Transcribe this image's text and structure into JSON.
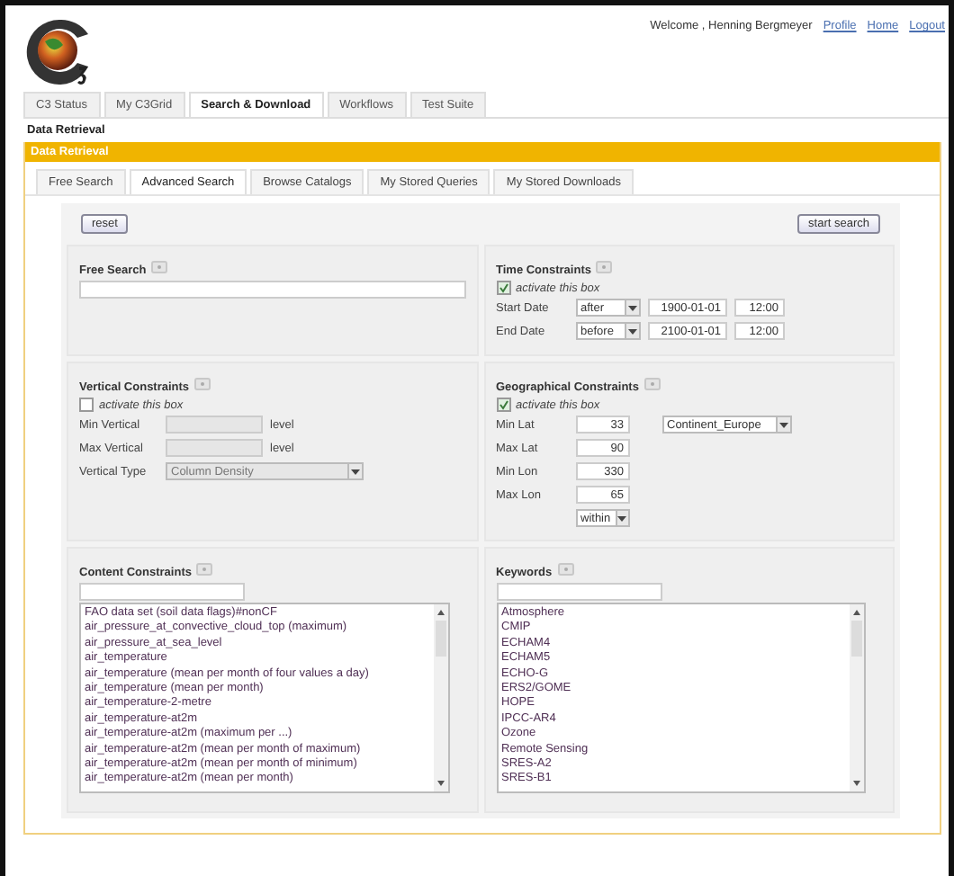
{
  "header": {
    "welcome": "Welcome , Henning Bergmeyer",
    "links": [
      "Profile",
      "Home",
      "Logout"
    ]
  },
  "main_tabs": [
    {
      "label": "C3 Status",
      "selected": false
    },
    {
      "label": "My C3Grid",
      "selected": false
    },
    {
      "label": "Search & Download",
      "selected": true
    },
    {
      "label": "Workflows",
      "selected": false
    },
    {
      "label": "Test Suite",
      "selected": false
    }
  ],
  "breadcrumb": "Data Retrieval",
  "panel": {
    "title": "Data Retrieval",
    "sub_tabs": [
      {
        "label": "Free Search",
        "selected": false
      },
      {
        "label": "Advanced Search",
        "selected": true
      },
      {
        "label": "Browse Catalogs",
        "selected": false
      },
      {
        "label": "My Stored Queries",
        "selected": false
      },
      {
        "label": "My Stored Downloads",
        "selected": false
      }
    ],
    "buttons": {
      "reset": "reset",
      "start": "start search"
    },
    "free_search": {
      "title": "Free Search"
    },
    "time_constraints": {
      "title": "Time Constraints",
      "activate": {
        "label": "activate this box",
        "checked": true
      },
      "rows": [
        {
          "label": "Start Date",
          "relation": "after",
          "date": "1900-01-01",
          "time": "12:00"
        },
        {
          "label": "End Date",
          "relation": "before",
          "date": "2100-01-01",
          "time": "12:00"
        }
      ]
    },
    "vertical_constraints": {
      "title": "Vertical Constraints",
      "activate": {
        "label": "activate this box",
        "checked": false
      },
      "disabled": true,
      "rows": [
        {
          "label": "Min Vertical",
          "unit": "level"
        },
        {
          "label": "Max Vertical",
          "unit": "level"
        }
      ],
      "type": {
        "label": "Vertical Type",
        "value": "Column Density"
      }
    },
    "geographical_constraints": {
      "title": "Geographical Constraints",
      "activate": {
        "label": "activate this box",
        "checked": true
      },
      "fields": [
        {
          "label": "Min Lat",
          "value": "33"
        },
        {
          "label": "Max Lat",
          "value": "90"
        },
        {
          "label": "Min Lon",
          "value": "330"
        },
        {
          "label": "Max Lon",
          "value": "65"
        }
      ],
      "mode": "within",
      "region": "Continent_Europe"
    },
    "content_constraints": {
      "title": "Content Constraints",
      "items": [
        "FAO data set (soil data flags)#nonCF",
        "air_pressure_at_convective_cloud_top (maximum)",
        "air_pressure_at_sea_level",
        "air_temperature",
        "air_temperature (mean per month of four values a day)",
        "air_temperature (mean per month)",
        "air_temperature-2-metre",
        "air_temperature-at2m",
        "air_temperature-at2m (maximum per ...)",
        "air_temperature-at2m (mean per month of maximum)",
        "air_temperature-at2m (mean per month of minimum)",
        "air_temperature-at2m (mean per month)"
      ]
    },
    "keywords": {
      "title": "Keywords",
      "items": [
        "Atmosphere",
        "CMIP",
        "ECHAM4",
        "ECHAM5",
        "ECHO-G",
        "ERS2/GOME",
        "HOPE",
        "IPCC-AR4",
        "Ozone",
        "Remote Sensing",
        "SRES-A2",
        "SRES-B1"
      ]
    }
  }
}
